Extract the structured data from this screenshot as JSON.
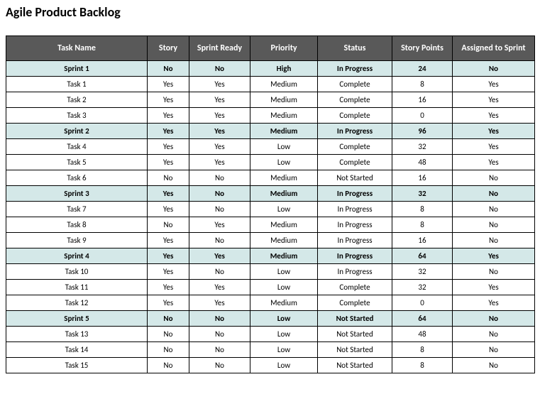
{
  "title": "Agile Product Backlog",
  "headers": {
    "task": "Task Name",
    "story": "Story",
    "ready": "Sprint Ready",
    "priority": "Priority",
    "status": "Status",
    "points": "Story Points",
    "assigned": "Assigned to Sprint"
  },
  "rows": [
    {
      "type": "sprint",
      "task": "Sprint 1",
      "story": "No",
      "ready": "No",
      "priority": "High",
      "status": "In Progress",
      "points": "24",
      "assigned": "No"
    },
    {
      "type": "task",
      "task": "Task 1",
      "story": "Yes",
      "ready": "Yes",
      "priority": "Medium",
      "status": "Complete",
      "points": "8",
      "assigned": "Yes"
    },
    {
      "type": "task",
      "task": "Task 2",
      "story": "Yes",
      "ready": "Yes",
      "priority": "Medium",
      "status": "Complete",
      "points": "16",
      "assigned": "Yes"
    },
    {
      "type": "task",
      "task": "Task 3",
      "story": "Yes",
      "ready": "Yes",
      "priority": "Medium",
      "status": "Complete",
      "points": "0",
      "assigned": "Yes"
    },
    {
      "type": "sprint",
      "task": "Sprint 2",
      "story": "Yes",
      "ready": "Yes",
      "priority": "Medium",
      "status": "In Progress",
      "points": "96",
      "assigned": "Yes"
    },
    {
      "type": "task",
      "task": "Task 4",
      "story": "Yes",
      "ready": "Yes",
      "priority": "Low",
      "status": "Complete",
      "points": "32",
      "assigned": "Yes"
    },
    {
      "type": "task",
      "task": "Task 5",
      "story": "Yes",
      "ready": "Yes",
      "priority": "Low",
      "status": "Complete",
      "points": "48",
      "assigned": "Yes"
    },
    {
      "type": "task",
      "task": "Task 6",
      "story": "No",
      "ready": "No",
      "priority": "Medium",
      "status": "Not Started",
      "points": "16",
      "assigned": "No"
    },
    {
      "type": "sprint",
      "task": "Sprint 3",
      "story": "Yes",
      "ready": "No",
      "priority": "Medium",
      "status": "In Progress",
      "points": "32",
      "assigned": "No"
    },
    {
      "type": "task",
      "task": "Task 7",
      "story": "Yes",
      "ready": "No",
      "priority": "Low",
      "status": "In Progress",
      "points": "8",
      "assigned": "No"
    },
    {
      "type": "task",
      "task": "Task 8",
      "story": "No",
      "ready": "Yes",
      "priority": "Medium",
      "status": "In Progress",
      "points": "8",
      "assigned": "No"
    },
    {
      "type": "task",
      "task": "Task 9",
      "story": "Yes",
      "ready": "No",
      "priority": "Medium",
      "status": "In Progress",
      "points": "16",
      "assigned": "No"
    },
    {
      "type": "sprint",
      "task": "Sprint 4",
      "story": "Yes",
      "ready": "Yes",
      "priority": "Medium",
      "status": "In Progress",
      "points": "64",
      "assigned": "Yes"
    },
    {
      "type": "task",
      "task": "Task 10",
      "story": "Yes",
      "ready": "No",
      "priority": "Low",
      "status": "In Progress",
      "points": "32",
      "assigned": "No"
    },
    {
      "type": "task",
      "task": "Task 11",
      "story": "Yes",
      "ready": "Yes",
      "priority": "Low",
      "status": "Complete",
      "points": "32",
      "assigned": "Yes"
    },
    {
      "type": "task",
      "task": "Task 12",
      "story": "Yes",
      "ready": "Yes",
      "priority": "Medium",
      "status": "Complete",
      "points": "0",
      "assigned": "Yes"
    },
    {
      "type": "sprint",
      "task": "Sprint 5",
      "story": "No",
      "ready": "No",
      "priority": "Low",
      "status": "Not Started",
      "points": "64",
      "assigned": "No"
    },
    {
      "type": "task",
      "task": "Task 13",
      "story": "No",
      "ready": "No",
      "priority": "Low",
      "status": "Not Started",
      "points": "48",
      "assigned": "No"
    },
    {
      "type": "task",
      "task": "Task 14",
      "story": "No",
      "ready": "No",
      "priority": "Low",
      "status": "Not Started",
      "points": "8",
      "assigned": "No"
    },
    {
      "type": "task",
      "task": "Task 15",
      "story": "No",
      "ready": "No",
      "priority": "Low",
      "status": "Not Started",
      "points": "8",
      "assigned": "No"
    }
  ]
}
